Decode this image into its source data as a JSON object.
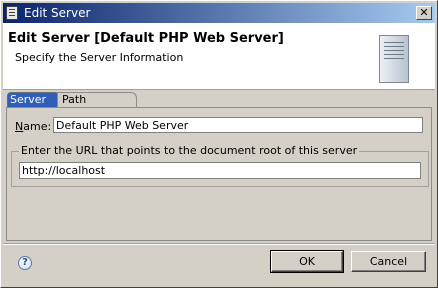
{
  "window": {
    "title": "Edit Server",
    "close_glyph": "✕"
  },
  "header": {
    "title": "Edit Server [Default PHP Web Server]",
    "subtitle": "Specify the Server Information",
    "icon": "server-icon"
  },
  "tabs": [
    {
      "label": "Server",
      "active": true
    },
    {
      "label": "Path Mapping",
      "active": false
    }
  ],
  "form": {
    "name_label_mnemonic": "N",
    "name_label_rest": "ame:",
    "name_value": "Default PHP Web Server",
    "url_group_label": "Enter the URL that points to the document root of this server",
    "url_value": "http://localhost"
  },
  "footer": {
    "help_glyph": "?",
    "ok_label": "OK",
    "cancel_label": "Cancel"
  },
  "colors": {
    "titlebar_start": "#0a246a",
    "titlebar_end": "#a6caf0",
    "active_tab": "#2f5fb8",
    "dialog_bg": "#d4d0c8"
  }
}
